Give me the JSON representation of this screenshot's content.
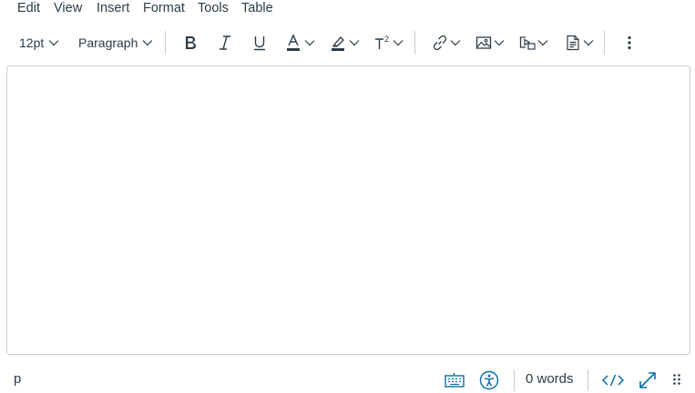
{
  "menubar": {
    "items": [
      "Edit",
      "View",
      "Insert",
      "Format",
      "Tools",
      "Table"
    ]
  },
  "toolbar": {
    "font_size": "12pt",
    "block_format": "Paragraph",
    "superscript_label": "T²"
  },
  "editor": {
    "content": ""
  },
  "statusbar": {
    "element_path": "p",
    "word_count": "0 words"
  },
  "colors": {
    "text": "#2d3b45",
    "accent": "#0770a3",
    "border": "#c7cdd1"
  }
}
